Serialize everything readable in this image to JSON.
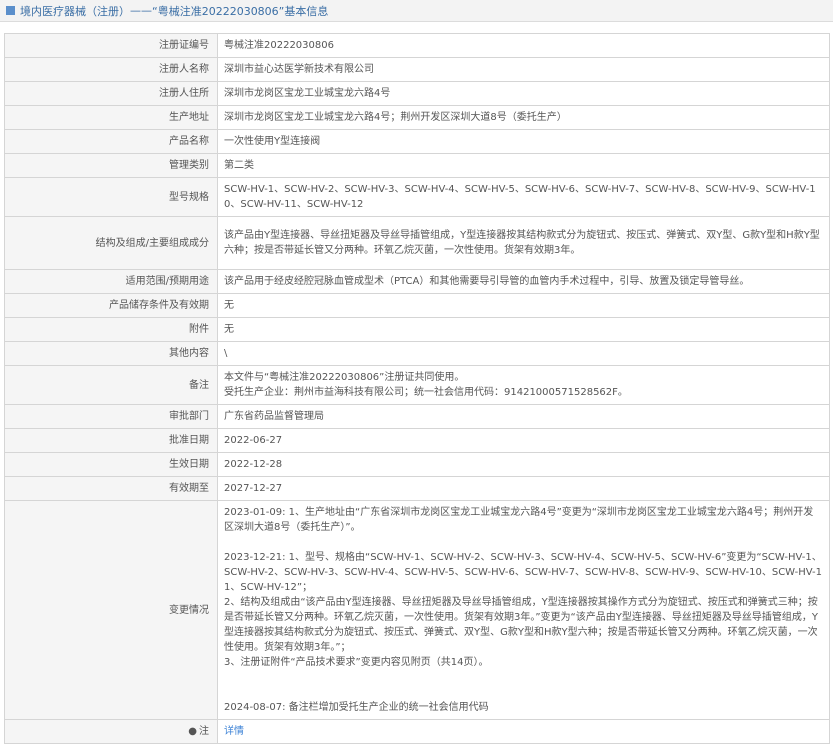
{
  "header": {
    "category": "境内医疗器械（注册）",
    "dash": "——",
    "title": "“粤械注准20222030806”基本信息"
  },
  "rows": {
    "reg_no": {
      "label": "注册证编号",
      "value": "粤械注准20222030806"
    },
    "registrant": {
      "label": "注册人名称",
      "value": "深圳市益心达医学新技术有限公司"
    },
    "registrant_addr": {
      "label": "注册人住所",
      "value": "深圳市龙岗区宝龙工业城宝龙六路4号"
    },
    "production_addr": {
      "label": "生产地址",
      "value": "深圳市龙岗区宝龙工业城宝龙六路4号；荆州开发区深圳大道8号（委托生产）"
    },
    "product_name": {
      "label": "产品名称",
      "value": "一次性使用Y型连接阀"
    },
    "category": {
      "label": "管理类别",
      "value": "第二类"
    },
    "model": {
      "label": "型号规格",
      "value": "SCW-HV-1、SCW-HV-2、SCW-HV-3、SCW-HV-4、SCW-HV-5、SCW-HV-6、SCW-HV-7、SCW-HV-8、SCW-HV-9、SCW-HV-10、SCW-HV-11、SCW-HV-12"
    },
    "structure": {
      "label": "结构及组成/主要组成成分",
      "value": "该产品由Y型连接器、导丝扭矩器及导丝导插管组成，Y型连接器按其结构款式分为旋钮式、按压式、弹簧式、双Y型、G款Y型和H款Y型六种；按是否带延长管又分两种。环氧乙烷灭菌，一次性使用。货架有效期3年。"
    },
    "scope": {
      "label": "适用范围/预期用途",
      "value": "该产品用于经皮经腔冠脉血管成型术（PTCA）和其他需要导引导管的血管内手术过程中，引导、放置及锁定导管导丝。"
    },
    "storage": {
      "label": "产品储存条件及有效期",
      "value": "无"
    },
    "attachment": {
      "label": "附件",
      "value": "无"
    },
    "other": {
      "label": "其他内容",
      "value": "\\"
    },
    "remark": {
      "label": "备注",
      "line1": "本文件与“粤械注准20222030806”注册证共同使用。",
      "line2": "受托生产企业：荆州市益海科技有限公司；统一社会信用代码：91421000571528562F。"
    },
    "dept": {
      "label": "审批部门",
      "value": "广东省药品监督管理局"
    },
    "approve_date": {
      "label": "批准日期",
      "value": "2022-06-27"
    },
    "effective_date": {
      "label": "生效日期",
      "value": "2022-12-28"
    },
    "expiry": {
      "label": "有效期至",
      "value": "2027-12-27"
    },
    "changes": {
      "label": "变更情况",
      "c1": "2023-01-09: 1、生产地址由“广东省深圳市龙岗区宝龙工业城宝龙六路4号”变更为“深圳市龙岗区宝龙工业城宝龙六路4号；荆州开发区深圳大道8号（委托生产）”。",
      "c2a": "2023-12-21: 1、型号、规格由“SCW-HV-1、SCW-HV-2、SCW-HV-3、SCW-HV-4、SCW-HV-5、SCW-HV-6”变更为“SCW-HV-1、SCW-HV-2、SCW-HV-3、SCW-HV-4、SCW-HV-5、SCW-HV-6、SCW-HV-7、SCW-HV-8、SCW-HV-9、SCW-HV-10、SCW-HV-11、SCW-HV-12”；",
      "c2b": "2、结构及组成由“该产品由Y型连接器、导丝扭矩器及导丝导插管组成，Y型连接器按其操作方式分为旋钮式、按压式和弹簧式三种；按是否带延长管又分两种。环氧乙烷灭菌，一次性使用。货架有效期3年。”变更为“该产品由Y型连接器、导丝扭矩器及导丝导插管组成，Y型连接器按其结构款式分为旋钮式、按压式、弹簧式、双Y型、G款Y型和H款Y型六种；按是否带延长管又分两种。环氧乙烷灭菌，一次性使用。货架有效期3年。”；",
      "c2c": "3、注册证附件“产品技术要求”变更内容见附页（共14页）。",
      "c3": "2024-08-07: 备注栏增加受托生产企业的统一社会信用代码"
    },
    "note": {
      "label": "注",
      "icon": "pin-icon",
      "value": "详情"
    }
  },
  "colors": {
    "link": "#3c82d6",
    "header_text": "#3a6ea5",
    "label_bg": "#f5f5f5"
  }
}
